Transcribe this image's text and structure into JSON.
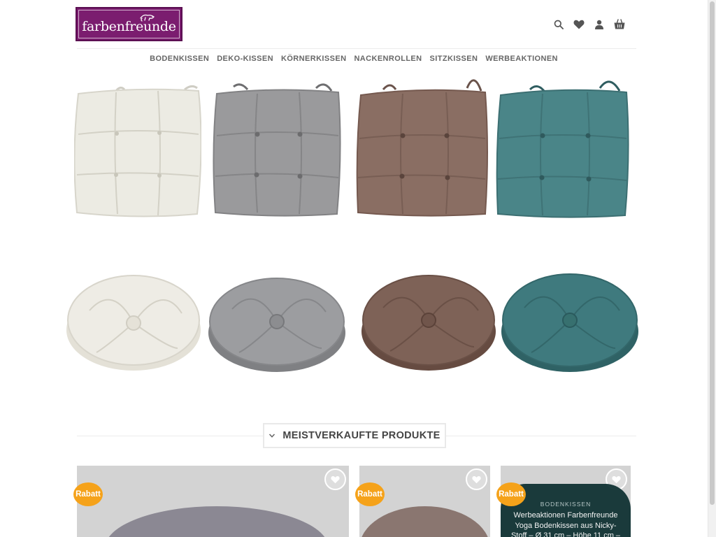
{
  "brand": {
    "logo_text": "farbenfreunde",
    "logo_bg_color": "#7b1d6f",
    "accent_color": "#f5a21a"
  },
  "header": {
    "icons": [
      "search-icon",
      "heart-icon",
      "user-icon",
      "basket-icon"
    ]
  },
  "nav": {
    "items": [
      {
        "label": "BODENKISSEN"
      },
      {
        "label": "DEKO-KISSEN"
      },
      {
        "label": "KÖRNERKISSEN"
      },
      {
        "label": "NACKENROLLEN"
      },
      {
        "label": "SITZKISSEN"
      },
      {
        "label": "WERBEAKTIONEN"
      }
    ]
  },
  "hero": {
    "square_cushion_colors": [
      "#ecebe3",
      "#9a9a9c",
      "#8a6e63",
      "#4a8588"
    ],
    "round_cushion_colors": [
      "#eeece5",
      "#9c9da0",
      "#7e6257",
      "#3f7a7e"
    ]
  },
  "section": {
    "title": "MEISTVERKAUFTE PRODUKTE"
  },
  "products": [
    {
      "badge": "Rabatt",
      "image_color": "#d2d2d2",
      "shape_color": "#8b8893"
    },
    {
      "badge": "Rabatt",
      "image_color": "#d4d4d4",
      "shape_color": "#8a7670"
    },
    {
      "badge": "Rabatt",
      "image_color": "#d6d6d6",
      "category": "BODENKISSEN",
      "name": "Werbeaktionen Farbenfreunde Yoga Bodenkissen aus Nicky-Stoff – Ø 31 cm – Höhe 11 cm –"
    }
  ]
}
